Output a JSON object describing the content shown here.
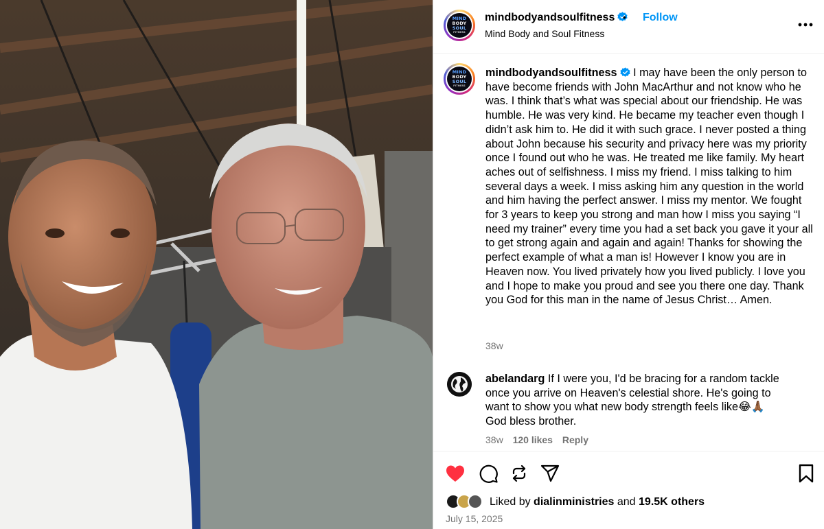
{
  "post": {
    "author": "mindbodyandsoulfitness",
    "display_name": "Mind Body and Soul Fitness",
    "follow_label": "Follow",
    "separator": "•",
    "avatar_logo": [
      "MIND",
      "BODY",
      "SOUL",
      "FITNESS"
    ],
    "caption": "I may have been the only person to have become friends with John MacArthur and not know who he was. I think that’s what was special about our friendship. He was humble. He was very kind. He became my teacher even though I didn’t ask him to. He did it with such grace. I never posted a thing about John because his security and privacy here was my priority once I found out who he was. He treated me like family. My heart aches out of selfishness. I miss my friend. I miss talking to him several days a week. I miss asking him any question in the world and him having the perfect answer. I miss my mentor. We fought for 3 years to keep you strong and man how I miss you saying “I need my trainer” every time you had a set back you gave it your all to get strong again and again and again! Thanks for showing the perfect example of what a man is! However I know you are in Heaven now. You lived privately how you lived publicly. I love you and I hope to make you proud and see you there one day. Thank you God for this man in the name of Jesus Christ… Amen.",
    "caption_time": "38w",
    "date": "July 15, 2025"
  },
  "comment": {
    "author": "abelandarg",
    "text": "If I were you, I'd be bracing for a random tackle once you arrive on Heaven's celestial shore. He's going to want to show you what new body strength feels like😂🙏🏾 God bless brother.",
    "time": "38w",
    "likes": "120 likes",
    "reply_label": "Reply"
  },
  "likes": {
    "prefix": "Liked by",
    "user": "dialinministries",
    "middle": "and",
    "count": "19.5K others"
  },
  "icons": {
    "more": "more-horizontal-icon",
    "verified": "verified-badge-icon",
    "like": "heart-filled-icon",
    "comment": "comment-bubble-icon",
    "repost": "repost-icon",
    "share": "send-icon",
    "save": "bookmark-icon"
  },
  "colors": {
    "follow": "#0095f6",
    "verified": "#0095f6",
    "liked_heart": "#ff3040",
    "secondary_text": "#737373"
  }
}
